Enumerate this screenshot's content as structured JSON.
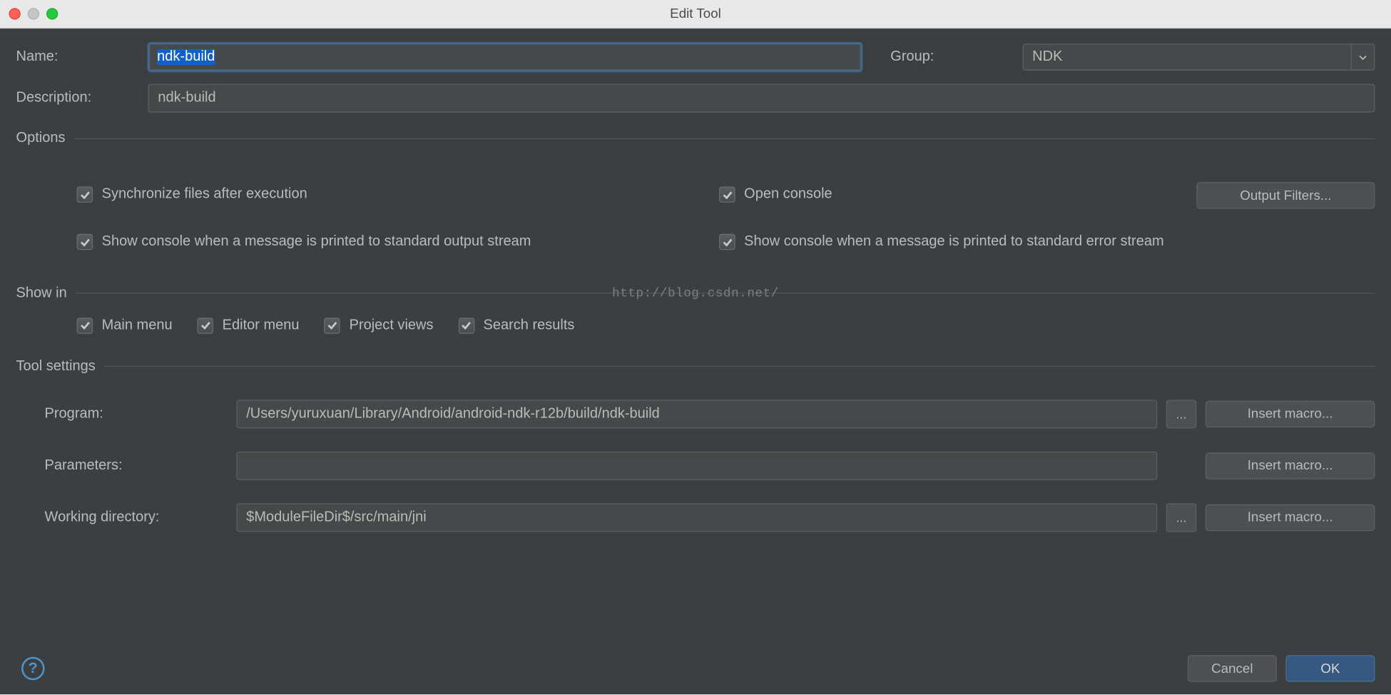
{
  "window": {
    "title": "Edit Tool"
  },
  "labels": {
    "name": "Name:",
    "group": "Group:",
    "description": "Description:",
    "options": "Options",
    "show_in": "Show in",
    "tool_settings": "Tool settings",
    "program": "Program:",
    "parameters": "Parameters:",
    "working_dir": "Working directory:"
  },
  "values": {
    "name": "ndk-build",
    "group": "NDK",
    "description": "ndk-build",
    "program": "/Users/yuruxuan/Library/Android/android-ndk-r12b/build/ndk-build",
    "parameters": "",
    "working_dir": "$ModuleFileDir$/src/main/jni"
  },
  "options": {
    "sync_files": "Synchronize files after execution",
    "open_console": "Open console",
    "stdout": "Show console when a message is printed to standard output stream",
    "stderr": "Show console when a message is printed to standard error stream"
  },
  "show_in": {
    "main_menu": "Main menu",
    "editor_menu": "Editor menu",
    "project_views": "Project views",
    "search_results": "Search results"
  },
  "buttons": {
    "output_filters": "Output Filters...",
    "insert_macro": "Insert macro...",
    "browse": "...",
    "cancel": "Cancel",
    "ok": "OK",
    "help": "?"
  },
  "watermark": "http://blog.csdn.net/"
}
